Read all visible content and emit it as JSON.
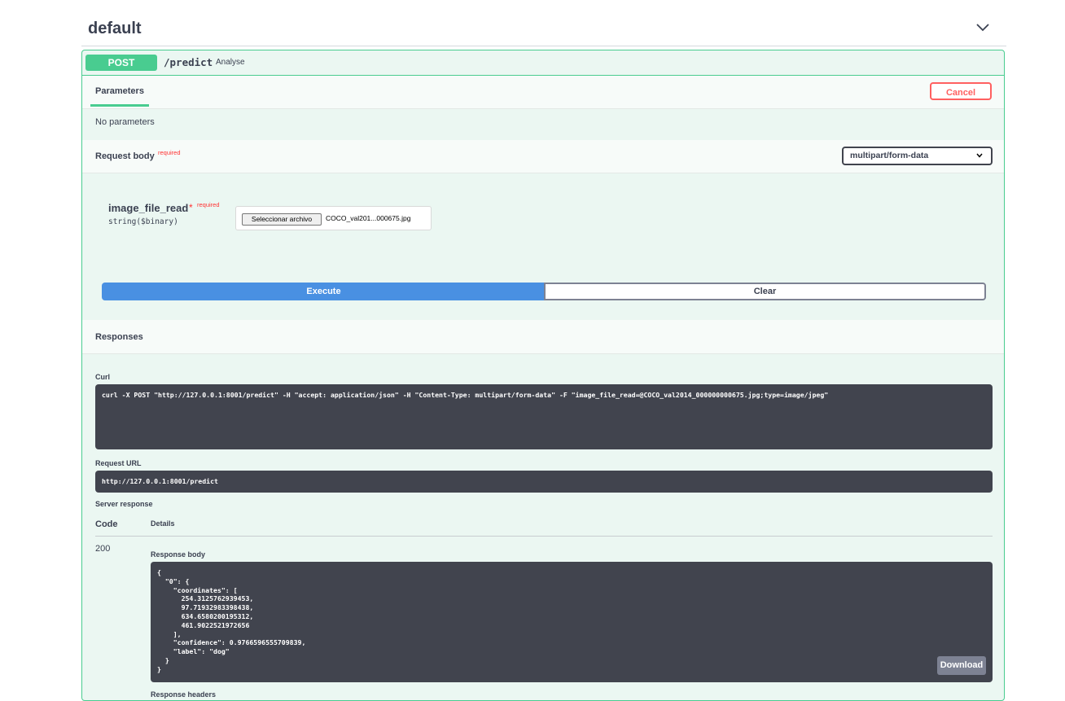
{
  "section": {
    "title": "default"
  },
  "operation": {
    "method": "POST",
    "path": "/predict",
    "description": "Analyse"
  },
  "parameters": {
    "tab_label": "Parameters",
    "cancel_label": "Cancel",
    "empty_text": "No parameters"
  },
  "request_body": {
    "label": "Request body",
    "required_label": "required",
    "content_type": "multipart/form-data",
    "field": {
      "name": "image_file_read",
      "star": "*",
      "required_label": "required",
      "type": "string($binary)",
      "file_button_label": "Seleccionar archivo",
      "file_name": "COCO_val201...000675.jpg"
    }
  },
  "actions": {
    "execute_label": "Execute",
    "clear_label": "Clear"
  },
  "responses": {
    "header": "Responses",
    "curl_label": "Curl",
    "curl_command": "curl -X POST \"http://127.0.0.1:8001/predict\" -H \"accept: application/json\" -H \"Content-Type: multipart/form-data\" -F \"image_file_read=@COCO_val2014_000000000675.jpg;type=image/jpeg\"",
    "request_url_label": "Request URL",
    "request_url": "http://127.0.0.1:8001/predict",
    "server_response_label": "Server response",
    "code_column": "Code",
    "details_column": "Details",
    "status_code": "200",
    "response_body_label": "Response body",
    "response_body": "{\n  \"0\": {\n    \"coordinates\": [\n      254.3125762939453,\n      97.71932983398438,\n      634.6580200195312,\n      461.9022521972656\n    ],\n    \"confidence\": 0.9766596555709839,\n    \"label\": \"dog\"\n  }\n}",
    "download_label": "Download",
    "response_headers_label": "Response headers"
  },
  "colors": {
    "post": "#49cc90",
    "execute": "#4990e2",
    "cancel": "#ff6060",
    "code_bg": "#41444e"
  }
}
